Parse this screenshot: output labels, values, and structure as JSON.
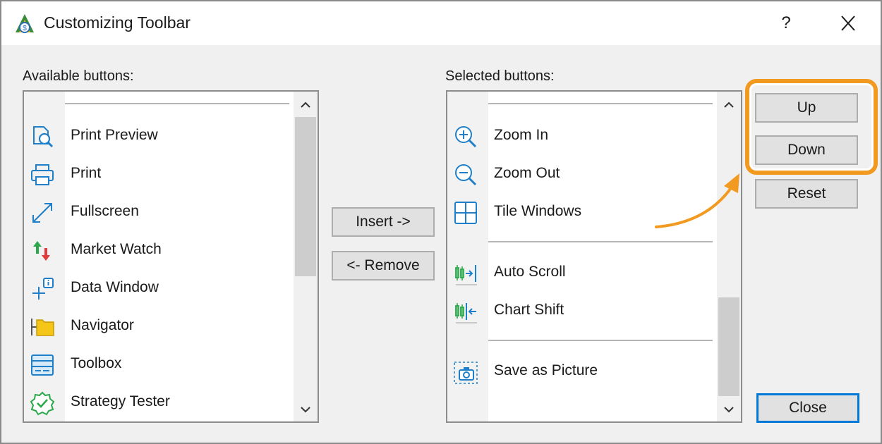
{
  "window": {
    "title": "Customizing Toolbar",
    "help_label": "?"
  },
  "available": {
    "label": "Available buttons:",
    "items": [
      {
        "label": "Print Preview",
        "icon": "print-preview-icon"
      },
      {
        "label": "Print",
        "icon": "printer-icon"
      },
      {
        "label": "Fullscreen",
        "icon": "fullscreen-icon"
      },
      {
        "label": "Market Watch",
        "icon": "market-watch-icon"
      },
      {
        "label": "Data Window",
        "icon": "data-window-icon"
      },
      {
        "label": "Navigator",
        "icon": "navigator-folder-icon"
      },
      {
        "label": "Toolbox",
        "icon": "toolbox-icon"
      },
      {
        "label": "Strategy Tester",
        "icon": "strategy-tester-icon"
      }
    ]
  },
  "selected": {
    "label": "Selected buttons:",
    "items": [
      {
        "label": "Zoom In",
        "icon": "zoom-in-icon"
      },
      {
        "label": "Zoom Out",
        "icon": "zoom-out-icon"
      },
      {
        "label": "Tile Windows",
        "icon": "tile-windows-icon"
      },
      {
        "label": "Auto Scroll",
        "icon": "auto-scroll-icon"
      },
      {
        "label": "Chart Shift",
        "icon": "chart-shift-icon"
      },
      {
        "label": "Save as Picture",
        "icon": "camera-icon"
      }
    ]
  },
  "buttons": {
    "insert": "Insert ->",
    "remove": "<- Remove",
    "up": "Up",
    "down": "Down",
    "reset": "Reset",
    "close": "Close"
  },
  "colors": {
    "highlight": "#f29a1f",
    "icon_blue": "#1f7fc9",
    "default_button_border": "#0078d7"
  }
}
